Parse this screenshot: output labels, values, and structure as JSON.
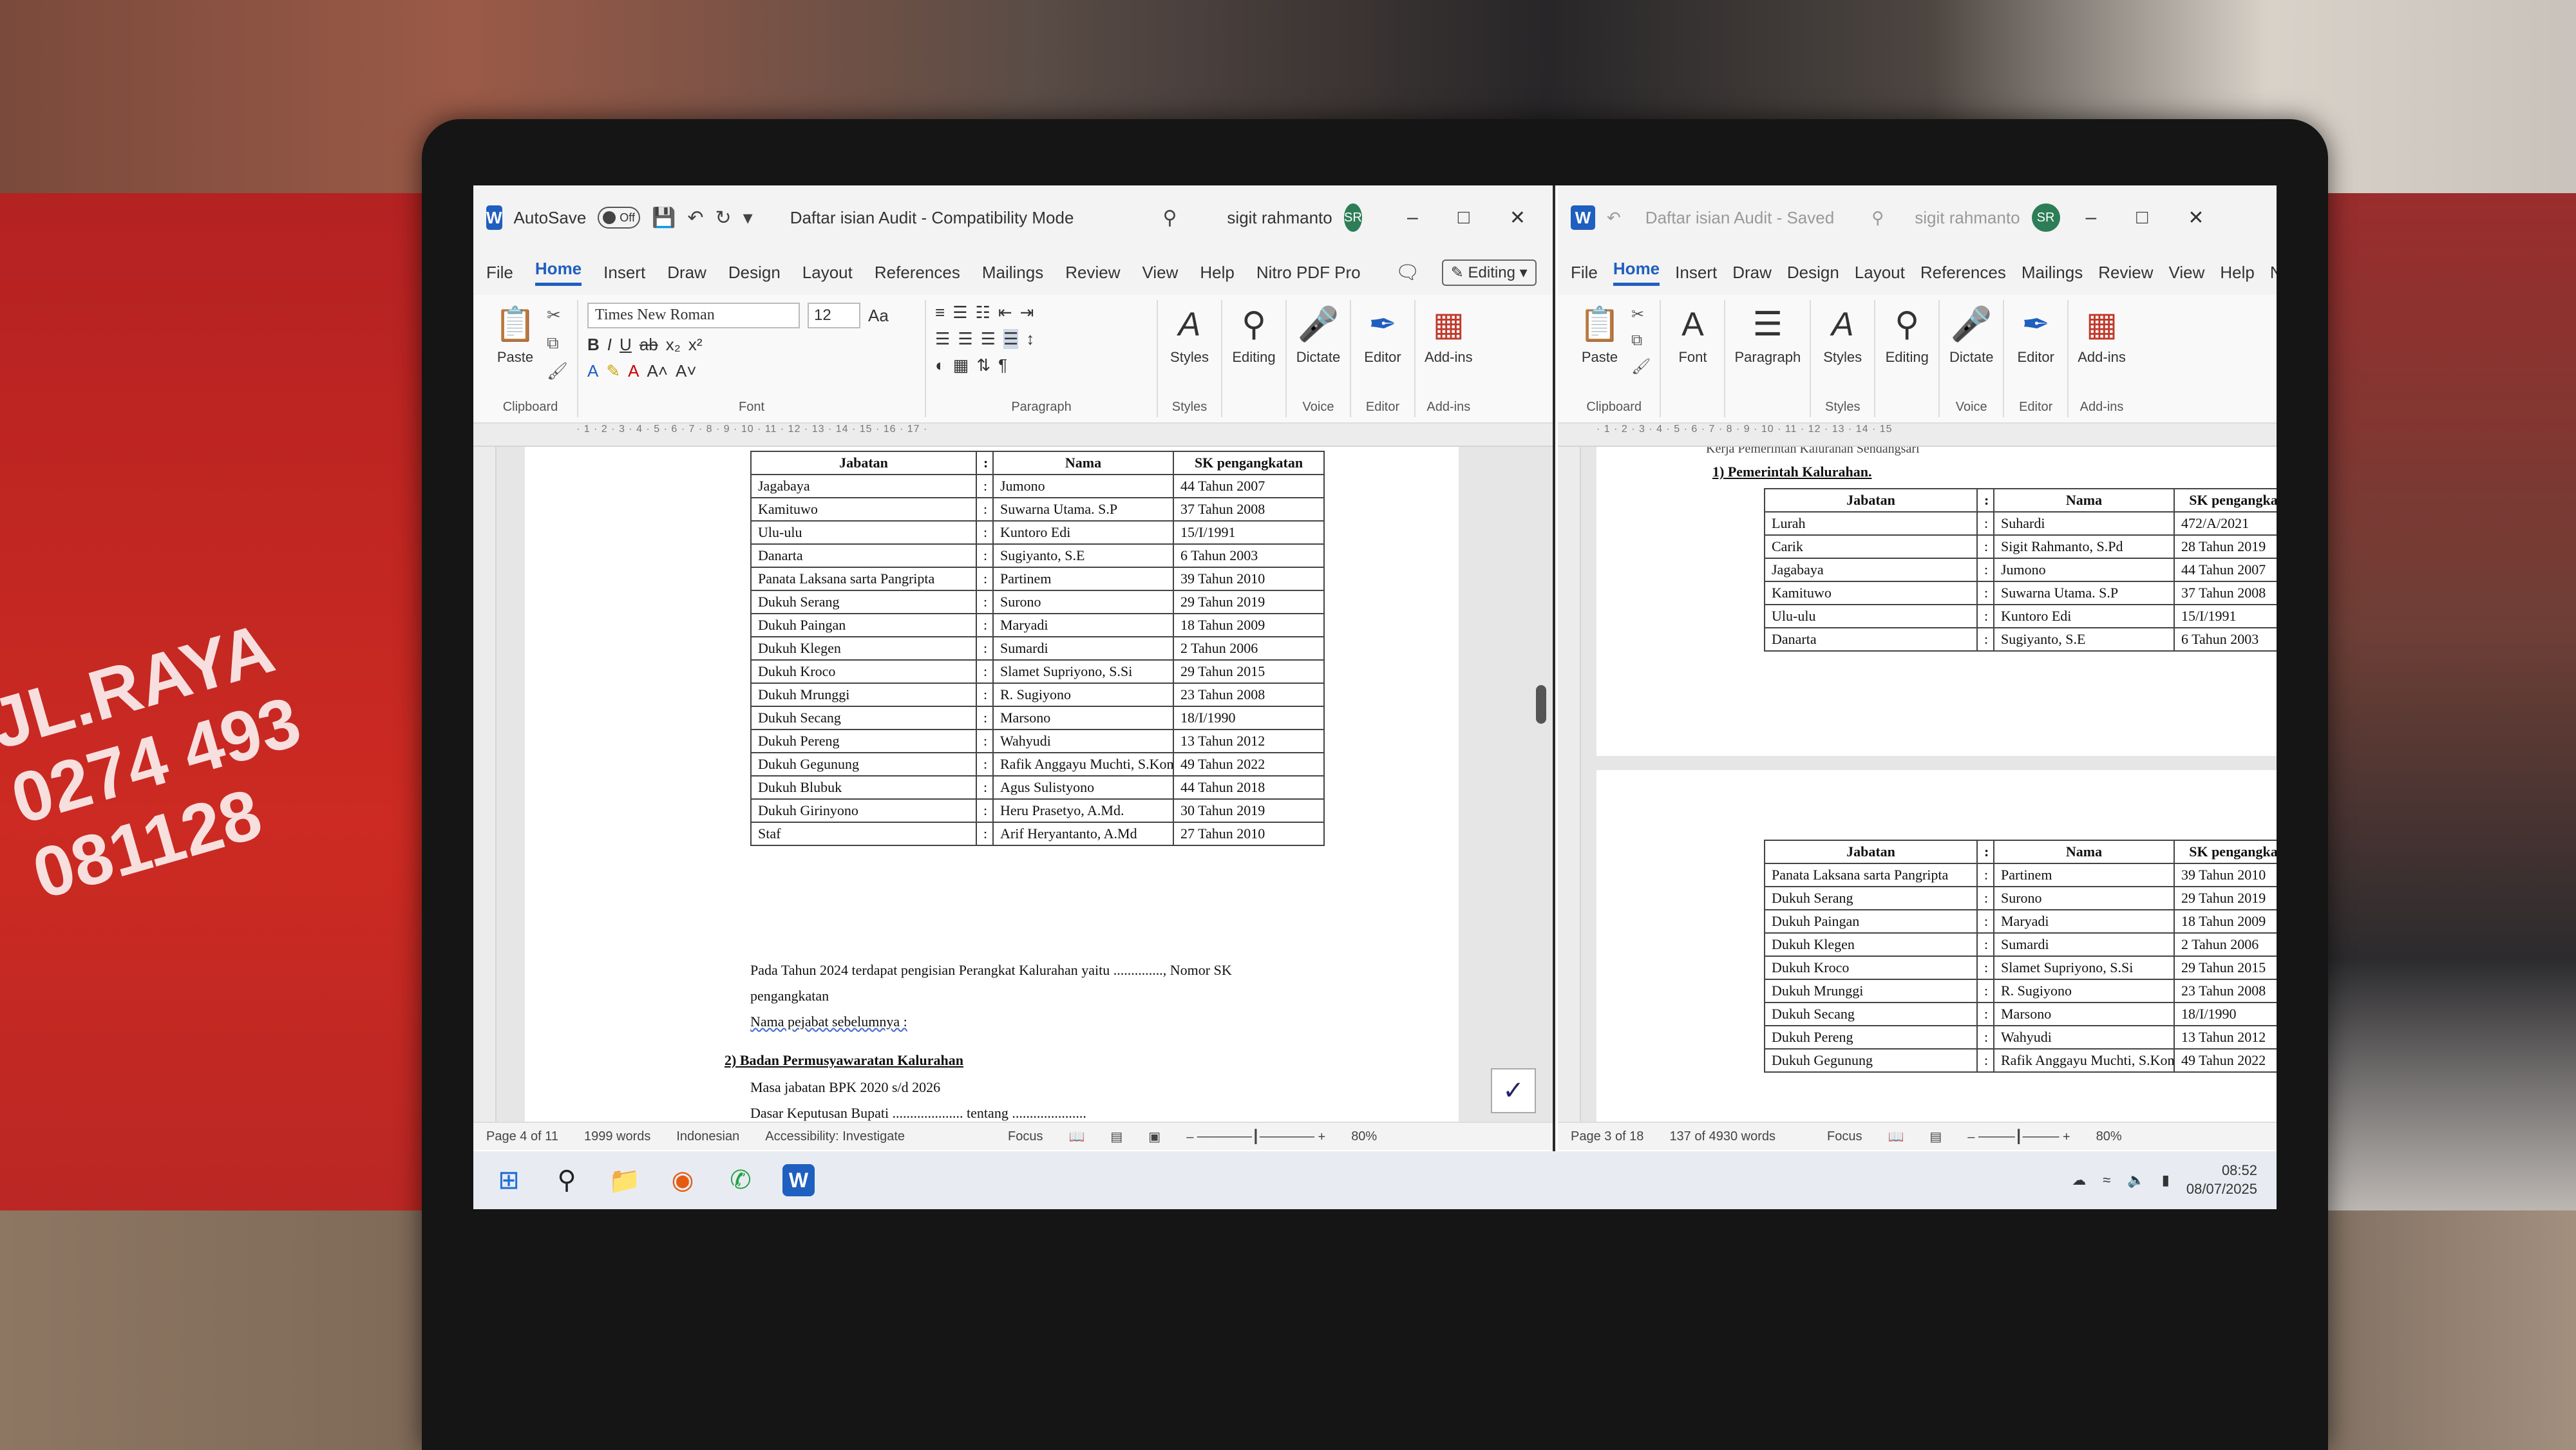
{
  "left_window": {
    "autosave_label": "AutoSave",
    "autosave_state": "Off",
    "title": "Daftar isian Audit  -  Compatibility Mode",
    "user": "sigit rahmanto",
    "user_initials": "SR",
    "menu": [
      "File",
      "Home",
      "Insert",
      "Draw",
      "Design",
      "Layout",
      "References",
      "Mailings",
      "Review",
      "View",
      "Help",
      "Nitro PDF Pro"
    ],
    "editing_label": "Editing",
    "ribbon": {
      "paste": "Paste",
      "clipboard": "Clipboard",
      "font_name": "Times New Roman",
      "font_size": "12",
      "font_group": "Font",
      "paragraph_group": "Paragraph",
      "styles": "Styles",
      "styles_group": "Styles",
      "editing": "Editing",
      "dictate": "Dictate",
      "voice_group": "Voice",
      "editor": "Editor",
      "editor_group": "Editor",
      "addins": "Add-ins",
      "addins_group": "Add-ins"
    },
    "table_headers": [
      "Jabatan",
      ":",
      "Nama",
      "SK pengangkatan"
    ],
    "table_rows": [
      [
        "Jagabaya",
        ":",
        "Jumono",
        "44 Tahun 2007"
      ],
      [
        "Kamituwo",
        ":",
        "Suwarna Utama. S.P",
        "37 Tahun 2008"
      ],
      [
        "Ulu-ulu",
        ":",
        "Kuntoro Edi",
        "15/I/1991"
      ],
      [
        "Danarta",
        ":",
        "Sugiyanto, S.E",
        "6 Tahun 2003"
      ],
      [
        "Panata Laksana sarta Pangripta",
        ":",
        "Partinem",
        "39 Tahun 2010"
      ],
      [
        "Dukuh Serang",
        ":",
        "Surono",
        "29 Tahun 2019"
      ],
      [
        "Dukuh Paingan",
        ":",
        "Maryadi",
        "18 Tahun 2009"
      ],
      [
        "Dukuh Klegen",
        ":",
        "Sumardi",
        "2 Tahun 2006"
      ],
      [
        "Dukuh Kroco",
        ":",
        "Slamet Supriyono, S.Si",
        "29 Tahun 2015"
      ],
      [
        "Dukuh Mrunggi",
        ":",
        "R. Sugiyono",
        "23 Tahun 2008"
      ],
      [
        "Dukuh Secang",
        ":",
        "Marsono",
        "18/I/1990"
      ],
      [
        "Dukuh Pereng",
        ":",
        "Wahyudi",
        "13 Tahun 2012"
      ],
      [
        "Dukuh Gegunung",
        ":",
        "Rafik Anggayu Muchti, S.Kom",
        "49 Tahun 2022"
      ],
      [
        "Dukuh Blubuk",
        ":",
        "Agus Sulistyono",
        "44 Tahun 2018"
      ],
      [
        "Dukuh Girinyono",
        ":",
        "Heru Prasetyo, A.Md.",
        "30 Tahun 2019"
      ],
      [
        "Staf",
        ":",
        "Arif Heryantanto, A.Md",
        "27 Tahun 2010"
      ]
    ],
    "para1": "Pada Tahun 2024 terdapat pengisian Perangkat  Kalurahan yaitu .............., Nomor SK",
    "para1b": "pengangkatan",
    "para2": "Nama pejabat sebelumnya :",
    "heading2": "2) Badan Permusyawaratan Kalurahan",
    "para3": "Masa jabatan  BPK 2020 s/d 2026",
    "para4": "Dasar Keputusan Bupati .................... tentang .....................",
    "status": {
      "page": "Page 4 of 11",
      "words": "1999 words",
      "language": "Indonesian",
      "accessibility": "Accessibility: Investigate",
      "focus": "Focus",
      "zoom": "80%"
    }
  },
  "right_window": {
    "title": "Daftar isian Audit  -  Saved",
    "user": "sigit rahmanto",
    "user_initials": "SR",
    "menu": [
      "File",
      "Home",
      "Insert",
      "Draw",
      "Design",
      "Layout",
      "References",
      "Mailings",
      "Review",
      "View",
      "Help",
      "Nitro"
    ],
    "ribbon": {
      "paste": "Paste",
      "clipboard": "Clipboard",
      "font": "Font",
      "paragraph": "Paragraph",
      "styles": "Styles",
      "styles_group": "Styles",
      "editing": "Editing",
      "dictate": "Dictate",
      "voice_group": "Voice",
      "editor": "Editor",
      "editor_group": "Editor",
      "addins": "Add-ins",
      "addins_group": "Add-ins"
    },
    "section_top": "Kerja Pemerintah Kalurahan Sendangsari",
    "heading1": "1) Pemerintah Kalurahan.",
    "table_headers": [
      "Jabatan",
      ":",
      "Nama",
      "SK pengangka"
    ],
    "table1_rows": [
      [
        "Lurah",
        ":",
        "Suhardi",
        "472/A/2021"
      ],
      [
        "Carik",
        ":",
        "Sigit Rahmanto, S.Pd",
        "28 Tahun 2019"
      ],
      [
        "Jagabaya",
        ":",
        "Jumono",
        "44 Tahun 2007"
      ],
      [
        "Kamituwo",
        ":",
        "Suwarna Utama. S.P",
        "37 Tahun 2008"
      ],
      [
        "Ulu-ulu",
        ":",
        "Kuntoro Edi",
        "15/I/1991"
      ],
      [
        "Danarta",
        ":",
        "Sugiyanto, S.E",
        "6 Tahun 2003"
      ]
    ],
    "table2_rows": [
      [
        "Panata Laksana sarta Pangripta",
        ":",
        "Partinem",
        "39 Tahun 2010"
      ],
      [
        "Dukuh Serang",
        ":",
        "Surono",
        "29 Tahun 2019"
      ],
      [
        "Dukuh Paingan",
        ":",
        "Maryadi",
        "18 Tahun 2009"
      ],
      [
        "Dukuh Klegen",
        ":",
        "Sumardi",
        "2 Tahun 2006"
      ],
      [
        "Dukuh Kroco",
        ":",
        "Slamet Supriyono, S.Si",
        "29 Tahun 2015"
      ],
      [
        "Dukuh Mrunggi",
        ":",
        "R. Sugiyono",
        "23 Tahun 2008"
      ],
      [
        "Dukuh Secang",
        ":",
        "Marsono",
        "18/I/1990"
      ],
      [
        "Dukuh Pereng",
        ":",
        "Wahyudi",
        "13 Tahun 2012"
      ],
      [
        "Dukuh Gegunung",
        ":",
        "Rafik Anggayu Muchti, S.Kom",
        "49 Tahun 2022"
      ]
    ],
    "status": {
      "page": "Page 3 of 18",
      "words": "137 of 4930 words",
      "focus": "Focus",
      "zoom": "80%"
    }
  },
  "taskbar": {
    "time": "08:52",
    "date": "08/07/2025"
  },
  "background": {
    "bag_text": [
      "JL.RAYA",
      "0274 493",
      "081128"
    ]
  }
}
